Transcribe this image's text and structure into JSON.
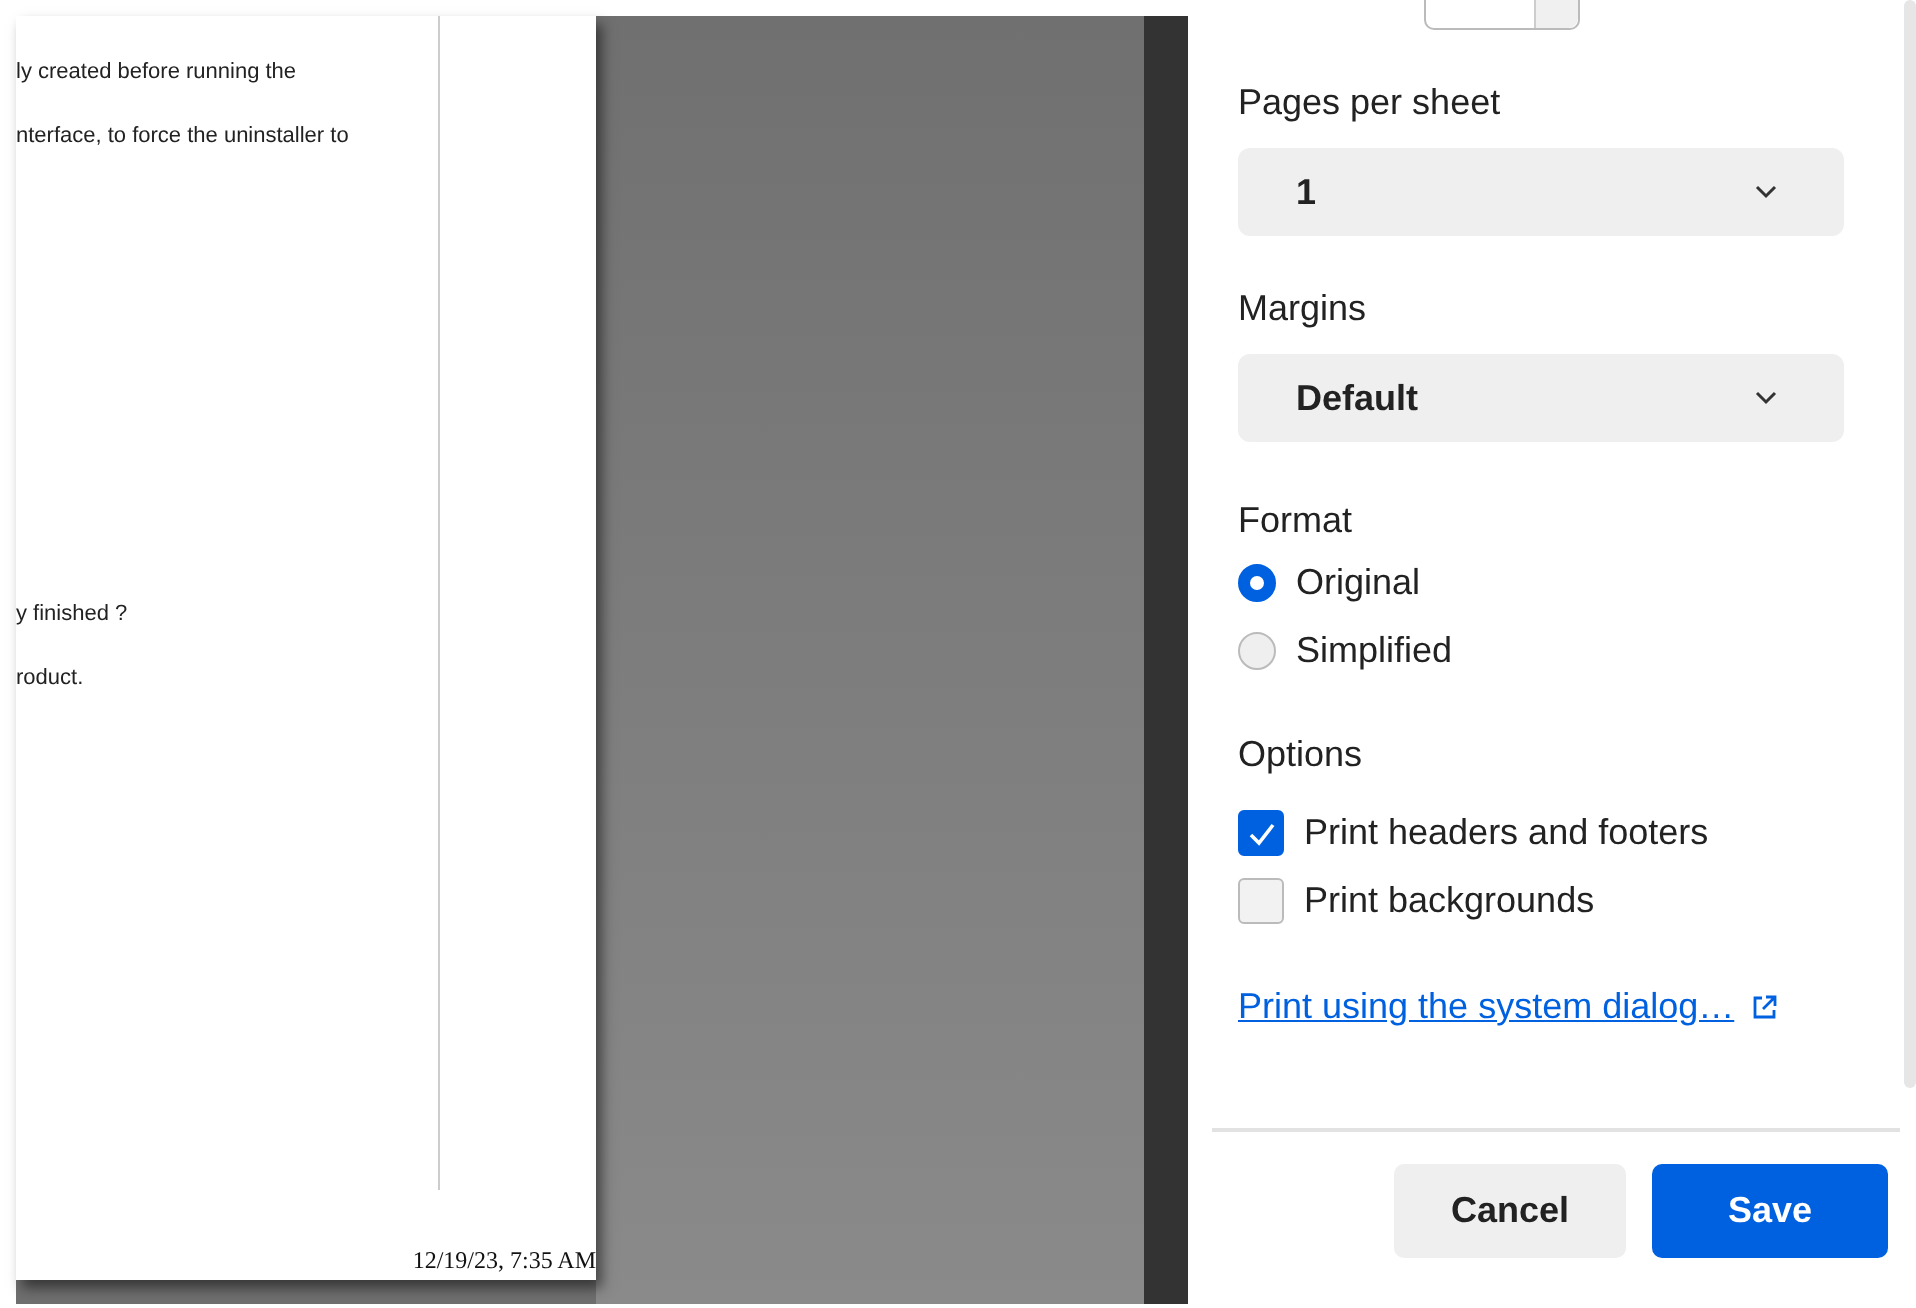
{
  "preview": {
    "page_blocks": [
      [
        "ly created before running the",
        "nterface, to force the uninstaller to"
      ],
      [
        "y finished ?",
        "roduct."
      ]
    ],
    "footer": "12/19/23, 7:35 AM"
  },
  "settings": {
    "pages_per_sheet": {
      "label": "Pages per sheet",
      "value": "1"
    },
    "margins": {
      "label": "Margins",
      "value": "Default"
    },
    "format": {
      "label": "Format",
      "options": [
        {
          "label": "Original",
          "selected": true
        },
        {
          "label": "Simplified",
          "selected": false
        }
      ]
    },
    "options": {
      "label": "Options",
      "items": [
        {
          "label": "Print headers and footers",
          "checked": true
        },
        {
          "label": "Print backgrounds",
          "checked": false
        }
      ]
    },
    "system_dialog_link": "Print using the system dialog…"
  },
  "buttons": [
    {
      "label": "Cancel",
      "kind": "secondary"
    },
    {
      "label": "Save",
      "kind": "primary"
    }
  ]
}
